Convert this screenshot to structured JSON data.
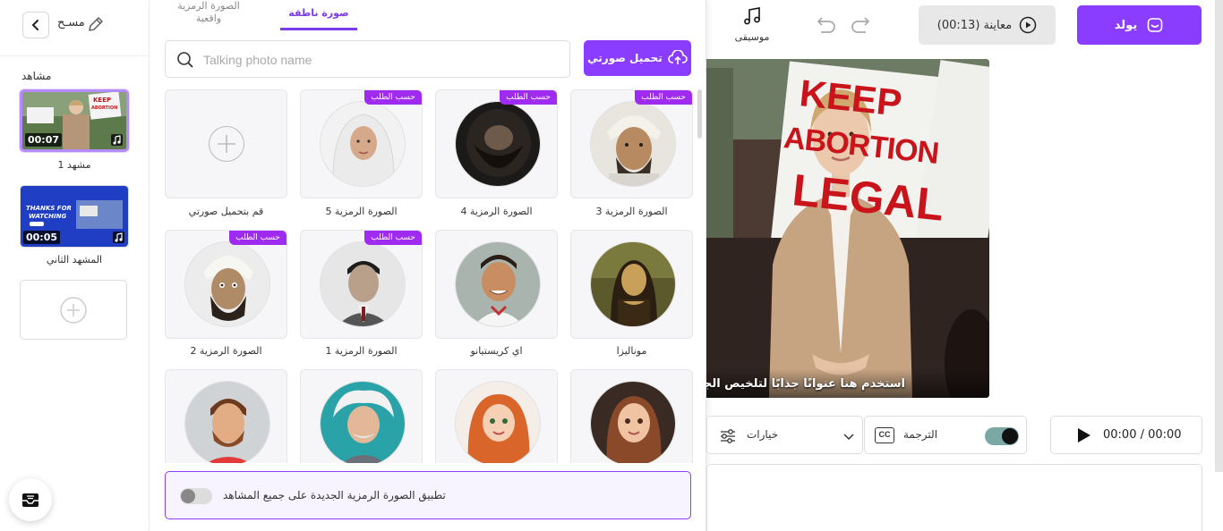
{
  "header": {
    "project_name": "مسـح",
    "music_label": "موسيقى",
    "preview_label": "معاينة (00:13)",
    "export_label": "يولد"
  },
  "scenes": {
    "title": "مشاهد",
    "items": [
      {
        "label": "مشهد 1",
        "duration": "00:07",
        "thumb_text": "KEEP ABORTION LEGAL"
      },
      {
        "label": "المشهد الثاني",
        "duration": "00:05",
        "thumb_text": "THANKS FOR WATCHING"
      }
    ]
  },
  "panel": {
    "tabs": [
      {
        "label": "صورة ناطقة",
        "active": true
      },
      {
        "label": "الصورة الرمزية واقعية",
        "active": false
      }
    ],
    "upload_button": "تحميل صورتي",
    "search_placeholder": "Talking photo name",
    "badge_text": "حسب الطلب",
    "cards": [
      {
        "label": "الصورة الرمزية 3",
        "badge": true
      },
      {
        "label": "الصورة الرمزية 4",
        "badge": true
      },
      {
        "label": "الصورة الرمزية 5",
        "badge": true
      },
      {
        "label": "قم بتحميل صورتي",
        "badge": false
      },
      {
        "label": "موناليزا",
        "badge": false
      },
      {
        "label": "اي كريستيانو",
        "badge": false
      },
      {
        "label": "الصورة الرمزية 1",
        "badge": true
      },
      {
        "label": "الصورة الرمزية 2",
        "badge": true
      }
    ],
    "apply_all_label": "تطبيق الصورة الرمزية الجديدة على جميع المشاهد"
  },
  "video": {
    "sign_text_1": "KEEP",
    "sign_text_2": "ABORTION",
    "sign_text_3": "LEGAL",
    "caption": "استخدم هنا عنوانًا جذابًا لتلخيص الجانب"
  },
  "controls": {
    "options_label": "خيارات",
    "subtitle_label": "الترجمة",
    "cc_text": "CC",
    "time": "00:00 / 00:00"
  },
  "colors": {
    "accent": "#8b3dff",
    "badge": "#a02bf0"
  }
}
